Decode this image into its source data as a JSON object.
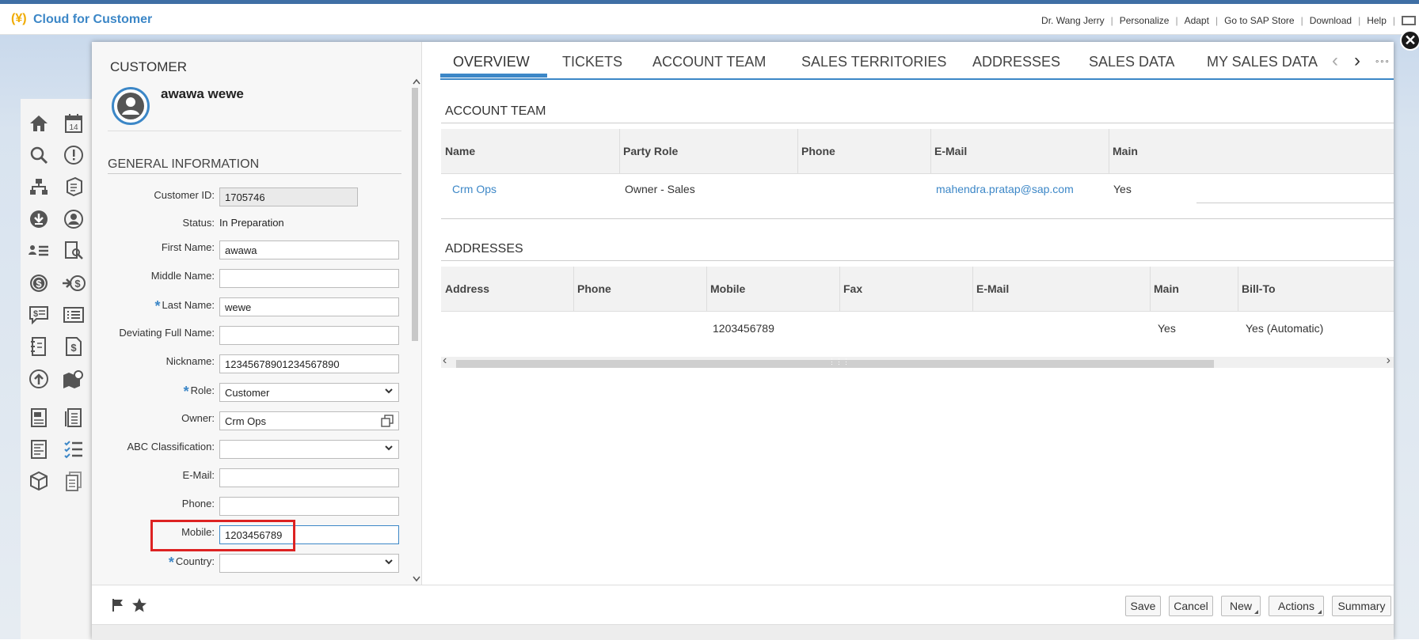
{
  "app": {
    "logo_glyph": "(¥)",
    "title": "Cloud for Customer"
  },
  "top_links": [
    {
      "label": "Dr. Wang Jerry"
    },
    {
      "label": "Personalize"
    },
    {
      "label": "Adapt"
    },
    {
      "label": "Go to SAP Store"
    },
    {
      "label": "Download"
    },
    {
      "label": "Help"
    }
  ],
  "nav_icons": [
    "home-icon",
    "calendar-icon",
    "search-icon",
    "alert-icon",
    "org-chart-icon",
    "cube-doc-icon",
    "download-icon",
    "person-icon",
    "people-list-icon",
    "doc-search-icon",
    "dollar-icon",
    "arrow-dollar-icon",
    "chat-dollar-icon",
    "list-icon",
    "notebook-icon",
    "invoice-icon",
    "upload-icon",
    "map-pin-icon",
    "report-icon",
    "document-icon",
    "report2-icon",
    "checklist-icon",
    "package-icon",
    "copy-doc-icon"
  ],
  "nav_glyphs": {
    "calendar": "14"
  },
  "close_glyph": "✕",
  "customer": {
    "heading": "CUSTOMER",
    "name": "awawa wewe"
  },
  "general_info": {
    "title": "GENERAL INFORMATION",
    "customer_id": {
      "label": "Customer ID:",
      "value": "1705746"
    },
    "status": {
      "label": "Status:",
      "value": "In Preparation"
    },
    "first_name": {
      "label": "First Name:",
      "value": "awawa"
    },
    "middle_name": {
      "label": "Middle Name:",
      "value": ""
    },
    "last_name": {
      "label": "Last Name:",
      "value": "wewe",
      "required": "*"
    },
    "deviating_full_name": {
      "label": "Deviating Full Name:",
      "value": ""
    },
    "nickname": {
      "label": "Nickname:",
      "value": "12345678901234567890"
    },
    "role": {
      "label": "Role:",
      "value": "Customer",
      "required": "*"
    },
    "owner": {
      "label": "Owner:",
      "value": "Crm Ops"
    },
    "abc_classification": {
      "label": "ABC Classification:",
      "value": ""
    },
    "email": {
      "label": "E-Mail:",
      "value": ""
    },
    "phone": {
      "label": "Phone:",
      "value": ""
    },
    "mobile": {
      "label": "Mobile:",
      "value": "1203456789"
    },
    "country": {
      "label": "Country:",
      "value": "",
      "required": "*"
    }
  },
  "tabs": [
    {
      "label": "OVERVIEW"
    },
    {
      "label": "TICKETS"
    },
    {
      "label": "ACCOUNT TEAM"
    },
    {
      "label": "SALES TERRITORIES"
    },
    {
      "label": "ADDRESSES"
    },
    {
      "label": "SALES DATA"
    },
    {
      "label": "MY SALES DATA"
    }
  ],
  "tab_nav": {
    "prev": "‹",
    "next": "›",
    "more": "∘∘∘"
  },
  "account_team": {
    "title": "ACCOUNT TEAM",
    "columns": [
      "Name",
      "Party Role",
      "Phone",
      "E-Mail",
      "Main"
    ],
    "rows": [
      {
        "name": "Crm Ops",
        "party_role": "Owner - Sales",
        "phone": "",
        "email": "mahendra.pratap@sap.com",
        "main": "Yes"
      }
    ]
  },
  "addresses": {
    "title": "ADDRESSES",
    "columns": [
      "Address",
      "Phone",
      "Mobile",
      "Fax",
      "E-Mail",
      "Main",
      "Bill-To"
    ],
    "rows": [
      {
        "address": "",
        "phone": "",
        "mobile": "1203456789",
        "fax": "",
        "email": "",
        "main": "Yes",
        "bill_to": "Yes (Automatic)"
      }
    ]
  },
  "scroll_glyphs": {
    "left": "‹",
    "right": "›",
    "grip": "⋮⋮⋮"
  },
  "footer": {
    "save": "Save",
    "cancel": "Cancel",
    "new": "New",
    "actions": "Actions",
    "summary": "Summary"
  }
}
